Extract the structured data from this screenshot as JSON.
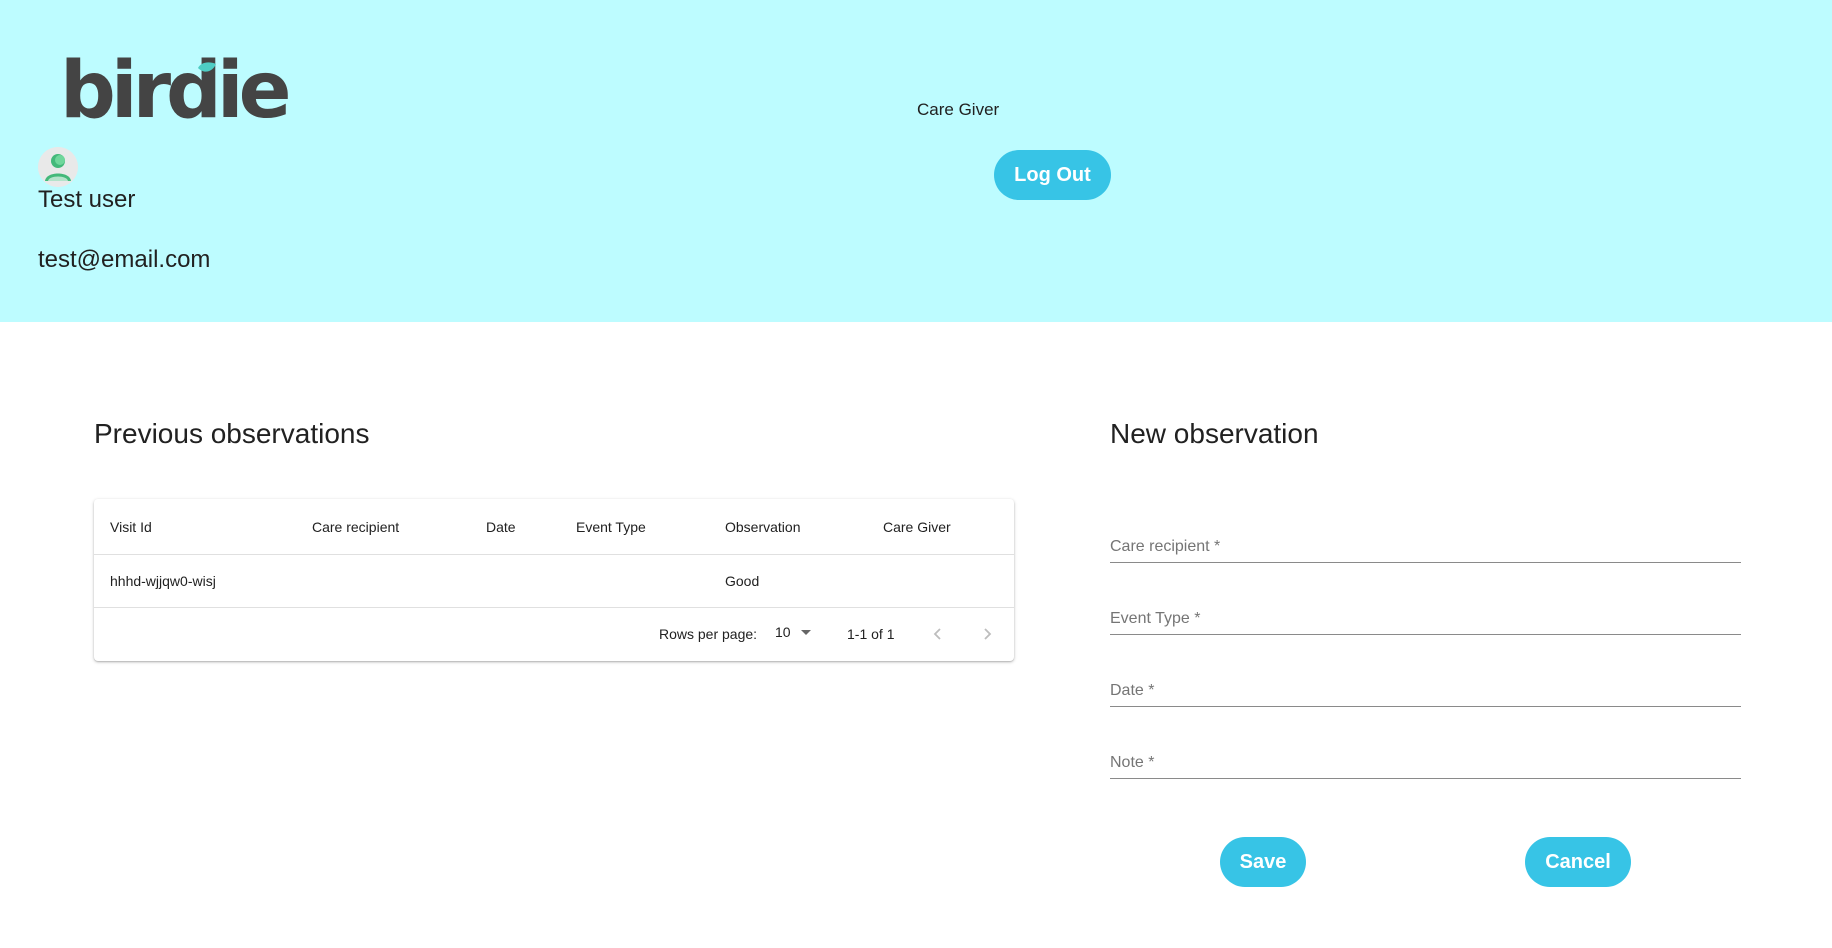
{
  "brand": {
    "logo_text": "birdie",
    "logo_color": "#444444",
    "accent_color": "#37c4e6",
    "header_bg": "#bdfcff"
  },
  "user": {
    "name": "Test user",
    "email": "test@email.com",
    "role": "Care Giver"
  },
  "header": {
    "logout_label": "Log Out"
  },
  "previous": {
    "title": "Previous observations",
    "columns": [
      "Visit Id",
      "Care recipient",
      "Date",
      "Event Type",
      "Observation",
      "Care Giver"
    ],
    "rows": [
      {
        "visit_id": "hhhd-wjjqw0-wisj",
        "care_recipient": "",
        "date": "",
        "event_type": "",
        "observation": "Good",
        "care_giver": ""
      }
    ],
    "pagination": {
      "rows_per_page_label": "Rows per page:",
      "rows_per_page": "10",
      "range": "1-1 of 1"
    }
  },
  "new_observation": {
    "title": "New observation",
    "fields": {
      "care_recipient": "Care recipient *",
      "event_type": "Event Type *",
      "date": "Date *",
      "note": "Note *"
    },
    "save_label": "Save",
    "cancel_label": "Cancel"
  }
}
